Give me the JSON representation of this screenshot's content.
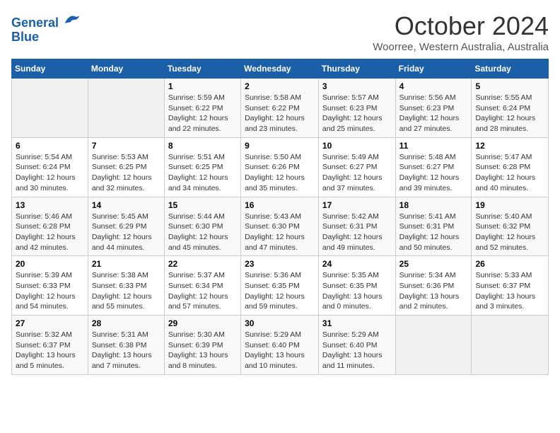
{
  "header": {
    "logo_line1": "General",
    "logo_line2": "Blue",
    "title": "October 2024",
    "location": "Woorree, Western Australia, Australia"
  },
  "columns": [
    "Sunday",
    "Monday",
    "Tuesday",
    "Wednesday",
    "Thursday",
    "Friday",
    "Saturday"
  ],
  "weeks": [
    [
      {
        "day": "",
        "detail": ""
      },
      {
        "day": "",
        "detail": ""
      },
      {
        "day": "1",
        "detail": "Sunrise: 5:59 AM\nSunset: 6:22 PM\nDaylight: 12 hours and 22 minutes."
      },
      {
        "day": "2",
        "detail": "Sunrise: 5:58 AM\nSunset: 6:22 PM\nDaylight: 12 hours and 23 minutes."
      },
      {
        "day": "3",
        "detail": "Sunrise: 5:57 AM\nSunset: 6:23 PM\nDaylight: 12 hours and 25 minutes."
      },
      {
        "day": "4",
        "detail": "Sunrise: 5:56 AM\nSunset: 6:23 PM\nDaylight: 12 hours and 27 minutes."
      },
      {
        "day": "5",
        "detail": "Sunrise: 5:55 AM\nSunset: 6:24 PM\nDaylight: 12 hours and 28 minutes."
      }
    ],
    [
      {
        "day": "6",
        "detail": "Sunrise: 5:54 AM\nSunset: 6:24 PM\nDaylight: 12 hours and 30 minutes."
      },
      {
        "day": "7",
        "detail": "Sunrise: 5:53 AM\nSunset: 6:25 PM\nDaylight: 12 hours and 32 minutes."
      },
      {
        "day": "8",
        "detail": "Sunrise: 5:51 AM\nSunset: 6:25 PM\nDaylight: 12 hours and 34 minutes."
      },
      {
        "day": "9",
        "detail": "Sunrise: 5:50 AM\nSunset: 6:26 PM\nDaylight: 12 hours and 35 minutes."
      },
      {
        "day": "10",
        "detail": "Sunrise: 5:49 AM\nSunset: 6:27 PM\nDaylight: 12 hours and 37 minutes."
      },
      {
        "day": "11",
        "detail": "Sunrise: 5:48 AM\nSunset: 6:27 PM\nDaylight: 12 hours and 39 minutes."
      },
      {
        "day": "12",
        "detail": "Sunrise: 5:47 AM\nSunset: 6:28 PM\nDaylight: 12 hours and 40 minutes."
      }
    ],
    [
      {
        "day": "13",
        "detail": "Sunrise: 5:46 AM\nSunset: 6:28 PM\nDaylight: 12 hours and 42 minutes."
      },
      {
        "day": "14",
        "detail": "Sunrise: 5:45 AM\nSunset: 6:29 PM\nDaylight: 12 hours and 44 minutes."
      },
      {
        "day": "15",
        "detail": "Sunrise: 5:44 AM\nSunset: 6:30 PM\nDaylight: 12 hours and 45 minutes."
      },
      {
        "day": "16",
        "detail": "Sunrise: 5:43 AM\nSunset: 6:30 PM\nDaylight: 12 hours and 47 minutes."
      },
      {
        "day": "17",
        "detail": "Sunrise: 5:42 AM\nSunset: 6:31 PM\nDaylight: 12 hours and 49 minutes."
      },
      {
        "day": "18",
        "detail": "Sunrise: 5:41 AM\nSunset: 6:31 PM\nDaylight: 12 hours and 50 minutes."
      },
      {
        "day": "19",
        "detail": "Sunrise: 5:40 AM\nSunset: 6:32 PM\nDaylight: 12 hours and 52 minutes."
      }
    ],
    [
      {
        "day": "20",
        "detail": "Sunrise: 5:39 AM\nSunset: 6:33 PM\nDaylight: 12 hours and 54 minutes."
      },
      {
        "day": "21",
        "detail": "Sunrise: 5:38 AM\nSunset: 6:33 PM\nDaylight: 12 hours and 55 minutes."
      },
      {
        "day": "22",
        "detail": "Sunrise: 5:37 AM\nSunset: 6:34 PM\nDaylight: 12 hours and 57 minutes."
      },
      {
        "day": "23",
        "detail": "Sunrise: 5:36 AM\nSunset: 6:35 PM\nDaylight: 12 hours and 59 minutes."
      },
      {
        "day": "24",
        "detail": "Sunrise: 5:35 AM\nSunset: 6:35 PM\nDaylight: 13 hours and 0 minutes."
      },
      {
        "day": "25",
        "detail": "Sunrise: 5:34 AM\nSunset: 6:36 PM\nDaylight: 13 hours and 2 minutes."
      },
      {
        "day": "26",
        "detail": "Sunrise: 5:33 AM\nSunset: 6:37 PM\nDaylight: 13 hours and 3 minutes."
      }
    ],
    [
      {
        "day": "27",
        "detail": "Sunrise: 5:32 AM\nSunset: 6:37 PM\nDaylight: 13 hours and 5 minutes."
      },
      {
        "day": "28",
        "detail": "Sunrise: 5:31 AM\nSunset: 6:38 PM\nDaylight: 13 hours and 7 minutes."
      },
      {
        "day": "29",
        "detail": "Sunrise: 5:30 AM\nSunset: 6:39 PM\nDaylight: 13 hours and 8 minutes."
      },
      {
        "day": "30",
        "detail": "Sunrise: 5:29 AM\nSunset: 6:40 PM\nDaylight: 13 hours and 10 minutes."
      },
      {
        "day": "31",
        "detail": "Sunrise: 5:29 AM\nSunset: 6:40 PM\nDaylight: 13 hours and 11 minutes."
      },
      {
        "day": "",
        "detail": ""
      },
      {
        "day": "",
        "detail": ""
      }
    ]
  ]
}
